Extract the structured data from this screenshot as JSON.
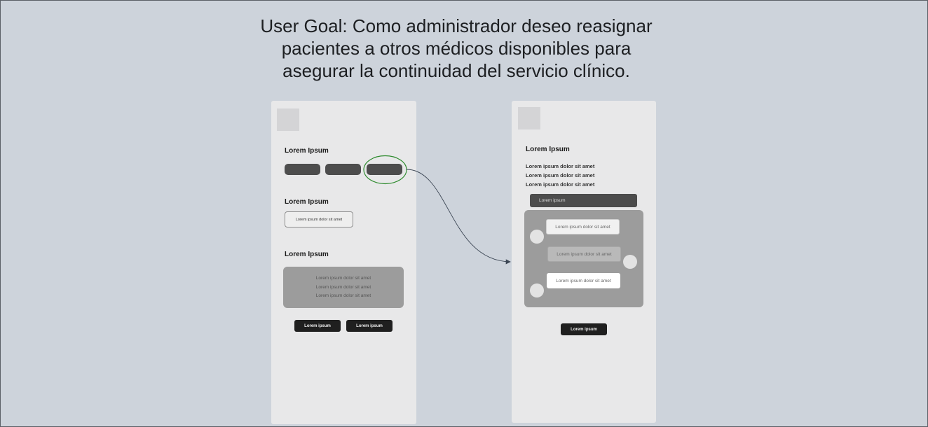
{
  "goal": {
    "line1": "User Goal: Como administrador deseo reasignar",
    "line2": "pacientes a otros médicos disponibles para",
    "line3": "asegurar la continuidad del servicio clínico."
  },
  "screen1": {
    "heading1": "Lorem Ipsum",
    "heading2": "Lorem Ipsum",
    "input_text": "Lorem ipsum dolor sit amet",
    "heading3": "Lorem Ipsum",
    "box_lines": [
      "Lorem ipsum dolor sit amet",
      "Lorem ipsum dolor sit amet",
      "Lorem ipsum dolor sit amet"
    ],
    "button1": "Lorem ipsum",
    "button2": "Lorem ipsum"
  },
  "screen2": {
    "heading": "Lorem Ipsum",
    "lines": [
      "Lorem ipsum dolor sit amet",
      "Lorem ipsum dolor sit amet",
      "Lorem ipsum dolor sit amet"
    ],
    "bar_label": "Lorem ipsum",
    "cards": [
      "Lorem ipsum dolor sit amet",
      "Lorem ipsum dolor sit amet",
      "Lorem ipsum dolor sit amet"
    ],
    "button": "Lorem ipsum"
  },
  "colors": {
    "background": "#cdd3db",
    "screen": "#e8e8e9",
    "highlight": "#2e8b2e",
    "connector": "#3c4654"
  }
}
